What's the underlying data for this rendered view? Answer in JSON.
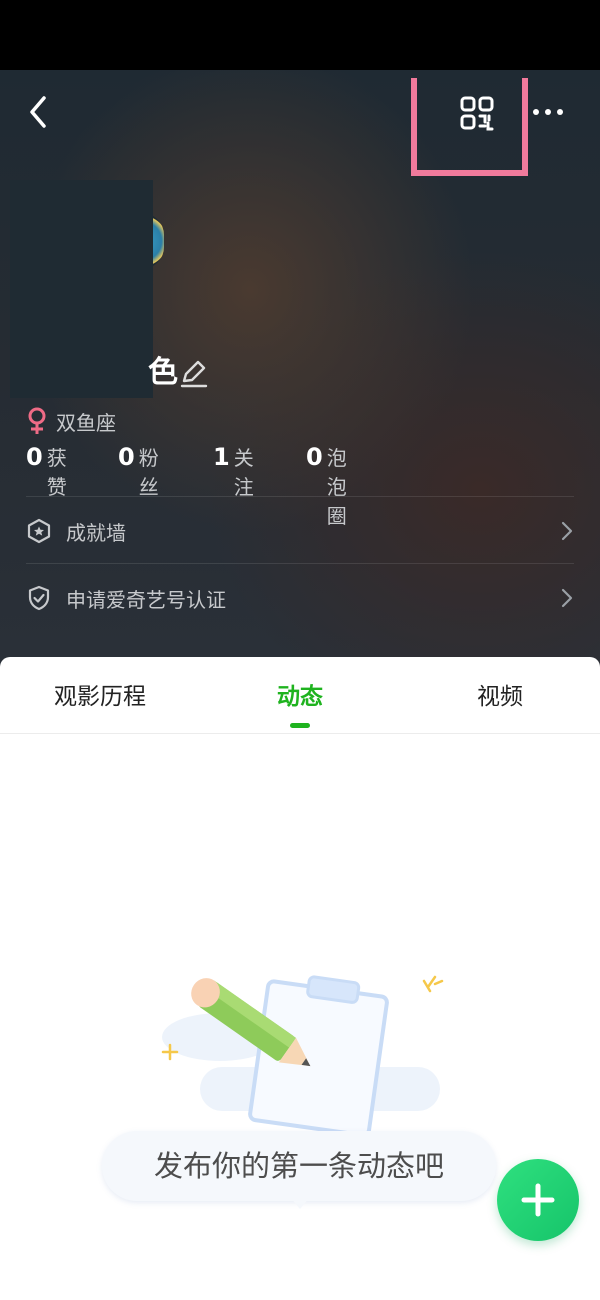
{
  "profile": {
    "name_fragment": "色",
    "zodiac": "双鱼座",
    "stats": [
      {
        "num": "0",
        "label": "获赞"
      },
      {
        "num": "0",
        "label": "粉丝"
      },
      {
        "num": "1",
        "label": "关注"
      },
      {
        "num": "0",
        "label": "泡泡圈"
      }
    ]
  },
  "menu": {
    "achievement": "成就墙",
    "verify": "申请爱奇艺号认证"
  },
  "tabs": [
    {
      "label": "观影历程"
    },
    {
      "label": "动态"
    },
    {
      "label": "视频"
    }
  ],
  "empty_state": {
    "message": "发布你的第一条动态吧"
  },
  "colors": {
    "accent_green": "#1fb31f",
    "highlight_pink": "#f07a9c",
    "fab_green": "#16c46a"
  },
  "icons": {
    "back": "chevron-left-icon",
    "qr": "qr-code-icon",
    "more": "more-dots-icon",
    "edit": "pencil-icon",
    "female": "female-icon",
    "achievement": "hexagon-star-icon",
    "verify": "shield-check-icon",
    "chevron": "chevron-right-icon",
    "add": "plus-icon"
  }
}
